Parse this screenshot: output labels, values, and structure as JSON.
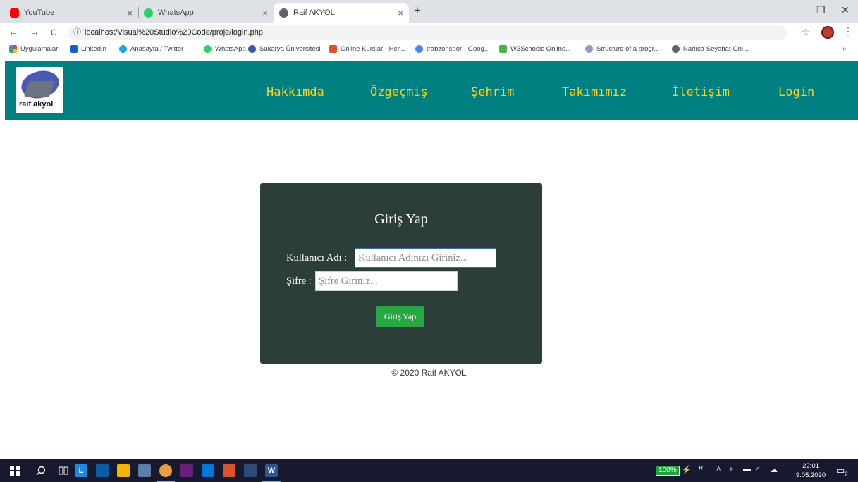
{
  "browser": {
    "tabs": [
      {
        "label": "YouTube",
        "close": "×"
      },
      {
        "label": "WhatsApp",
        "close": "×"
      },
      {
        "label": "Raif AKYOL",
        "close": "×"
      }
    ],
    "new_tab": "+",
    "window_controls": {
      "minimize": "–",
      "maximize": "❐",
      "close": "✕"
    },
    "nav": {
      "back": "←",
      "forward": "→",
      "reload": "C"
    },
    "url": "localhost/Visual%20Studio%20Code/proje/login.php",
    "url_info": "ⓘ",
    "bookmark_star": "☆",
    "menu": "⋮",
    "bookmarks": [
      {
        "label": "Uygulamalar"
      },
      {
        "label": "LinkedIn"
      },
      {
        "label": "Anasayfa / Twitter"
      },
      {
        "label": "WhatsApp"
      },
      {
        "label": "Sakarya Üniversitesi"
      },
      {
        "label": "Online Kurslar - Her..."
      },
      {
        "label": "trabzonspor - Goog..."
      },
      {
        "label": "W3Schools Online..."
      },
      {
        "label": "Structure of a progr..."
      },
      {
        "label": "Narlıca Seyahat Onl..."
      }
    ],
    "bookmarks_more": "»"
  },
  "site": {
    "logo_text": "raif akyol",
    "menu": [
      {
        "label": "Hakkımda"
      },
      {
        "label": "Özgeçmiş"
      },
      {
        "label": "Şehrim"
      },
      {
        "label": "Takımımız"
      },
      {
        "label": "İletişim"
      },
      {
        "label": "Login"
      }
    ],
    "login": {
      "title": "Giriş Yap",
      "username_label": "Kullanıcı Adı :",
      "username_placeholder": "Kullanıcı Adınızı Giriniz...",
      "password_label": "Şifre :",
      "password_placeholder": "Şifre Giriniz...",
      "submit_label": "Giriş Yap"
    },
    "footer": "© 2020 Raif AKYOL"
  },
  "taskbar": {
    "battery": "100%",
    "time": "22:01",
    "date": "9.05.2020",
    "notifications": "2"
  },
  "colors": {
    "nav_bg": "#008080",
    "nav_text": "#ffd11a",
    "card_bg": "#2c3e3a",
    "button_bg": "#28a745"
  }
}
